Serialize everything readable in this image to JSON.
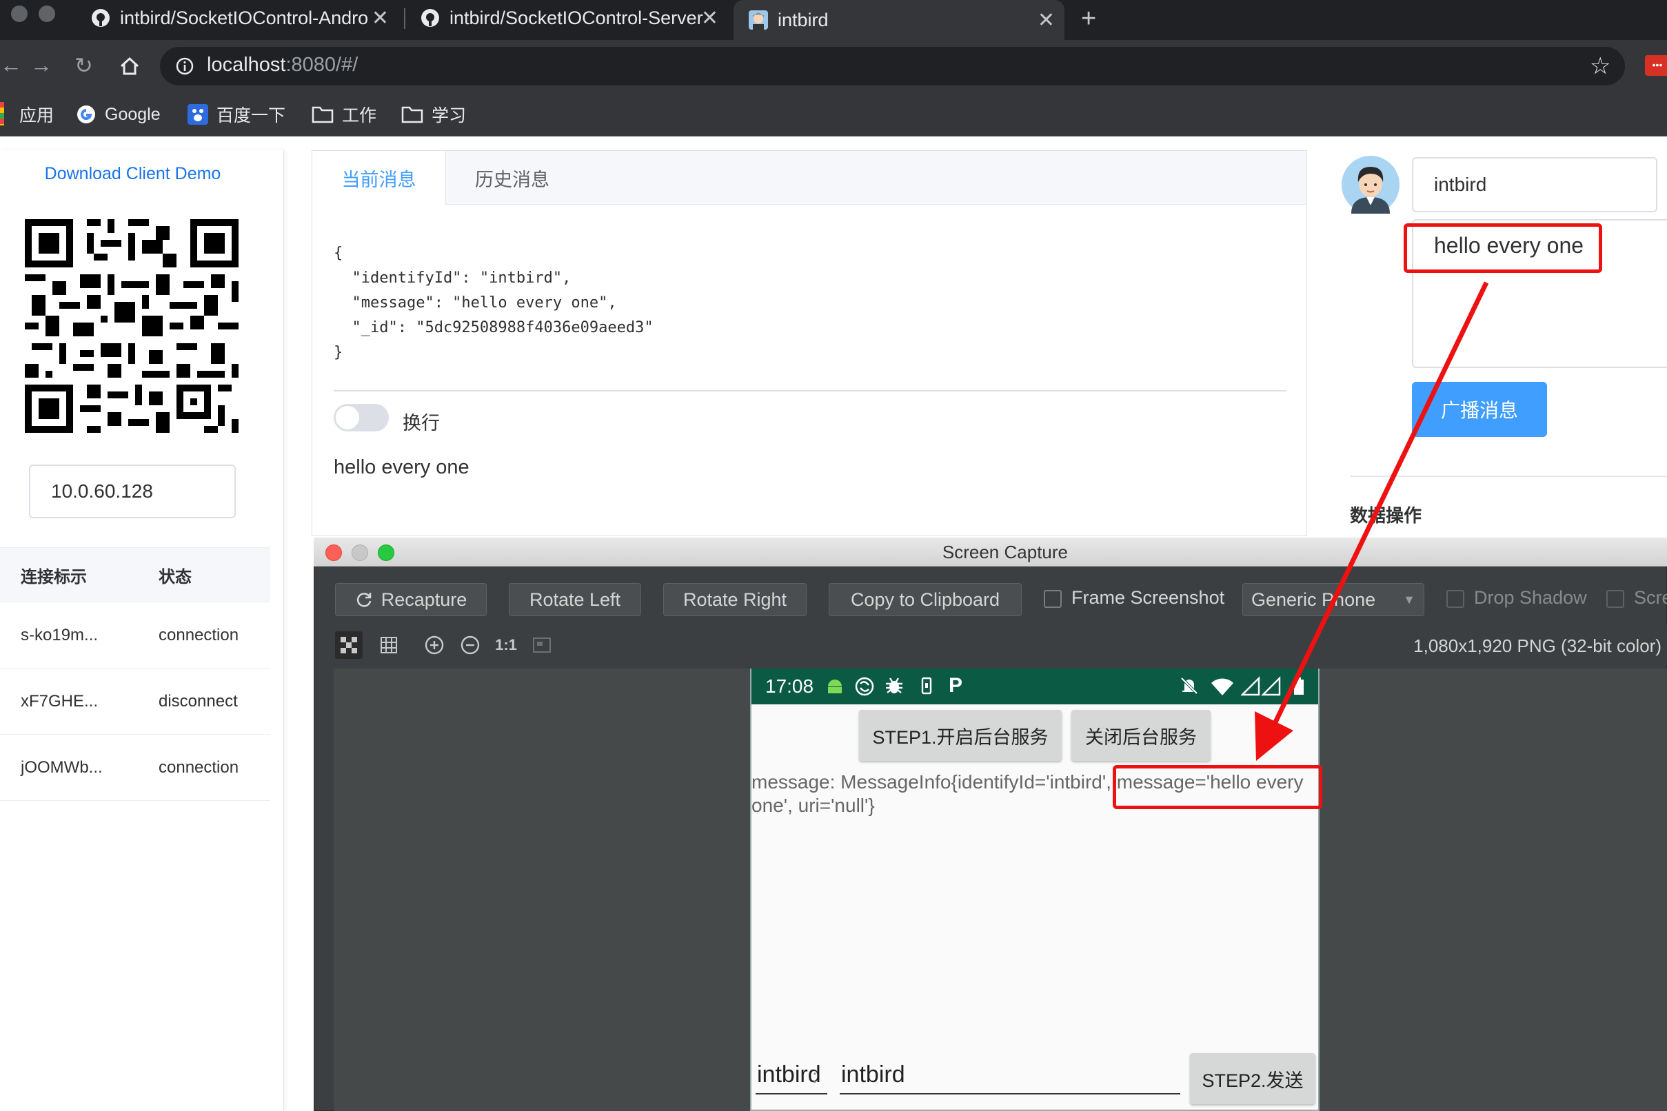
{
  "browser": {
    "tabs": [
      {
        "title": "intbird/SocketIOControl-Andro"
      },
      {
        "title": "intbird/SocketIOControl-Server"
      },
      {
        "title": "intbird"
      }
    ],
    "url_host": "localhost",
    "url_rest": ":8080/#/",
    "bookmarks": [
      "应用",
      "Google",
      "百度一下",
      "工作",
      "学习"
    ]
  },
  "left_panel": {
    "download_link": "Download Client Demo",
    "ip_value": "10.0.60.128",
    "table": {
      "headers": [
        "连接标示",
        "状态"
      ],
      "rows": [
        [
          "s-ko19m...",
          "connection"
        ],
        [
          "xF7GHE...",
          "disconnect"
        ],
        [
          "jOOMWb...",
          "connection"
        ]
      ]
    }
  },
  "message_panel": {
    "tabs": [
      "当前消息",
      "历史消息"
    ],
    "json_lines": [
      "{",
      "  \"identifyId\": \"intbird\",",
      "  \"message\": \"hello every one\",",
      "  \"_id\": \"5dc92508988f4036e09aeed3\"",
      "}"
    ],
    "wrap_label": "换行",
    "message_text": "hello every one"
  },
  "right_panel": {
    "name_value": "intbird",
    "message_value": "hello every one",
    "broadcast_label": "广播消息",
    "data_ops_label": "数据操作"
  },
  "screen_capture": {
    "title": "Screen Capture",
    "buttons": [
      "Recapture",
      "Rotate Left",
      "Rotate Right",
      "Copy to Clipboard"
    ],
    "frame_label": "Frame Screenshot",
    "device_select": "Generic Phone",
    "drop_shadow_label": "Drop Shadow",
    "screen_glare_label": "Scre",
    "zoom_label": "1:1",
    "image_info": "1,080x1,920 PNG (32-bit color)"
  },
  "phone": {
    "time": "17:08",
    "start_button": "STEP1.开启后台服务",
    "stop_button": "关闭后台服务",
    "log_line1": "message: MessageInfo{identifyId='intbird', message='hello every",
    "log_line2": "one', uri='null'}",
    "nick_label": "intbird",
    "colon": ":",
    "nick_value": "intbird",
    "send_button": "STEP2.发送"
  },
  "colors": {
    "accent": "#409eff",
    "annotation_red": "#ee1111",
    "status_bar": "#0b5a43"
  }
}
